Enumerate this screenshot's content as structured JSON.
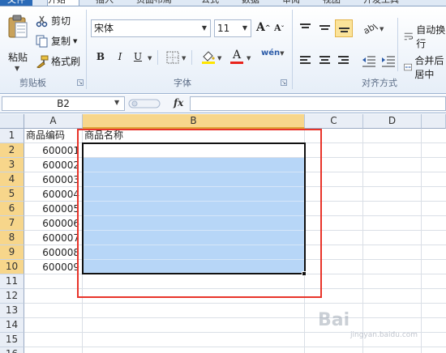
{
  "tabs": [
    "文件",
    "开始",
    "插入",
    "页面布局",
    "公式",
    "数据",
    "审阅",
    "视图",
    "开发工具"
  ],
  "clipboard": {
    "paste_label": "粘贴",
    "cut_label": "剪切",
    "copy_label": "复制",
    "format_painter_label": "格式刷",
    "group_label": "剪贴板"
  },
  "font": {
    "font_name": "宋体",
    "font_size": "11",
    "bold": "B",
    "italic": "I",
    "underline": "U",
    "grow": "A",
    "shrink": "A",
    "phonetic": "wén",
    "group_label": "字体"
  },
  "alignment": {
    "wrap_label": "自动换行",
    "merge_label": "合并后居中",
    "group_label": "对齐方式"
  },
  "formula_bar": {
    "name_box": "B2",
    "fx": "fx",
    "formula": ""
  },
  "sheet": {
    "columns": [
      "A",
      "B",
      "C",
      "D"
    ],
    "rows": [
      "1",
      "2",
      "3",
      "4",
      "5",
      "6",
      "7",
      "8",
      "9",
      "10",
      "11",
      "12",
      "13",
      "14",
      "15",
      "16"
    ],
    "header_a1": "商品编码",
    "header_b1": "商品名称",
    "codes": [
      "600001",
      "600002",
      "600003",
      "600004",
      "600005",
      "600006",
      "600007",
      "600008",
      "600009"
    ]
  },
  "watermark": {
    "text": "Bai",
    "sub": "jingyan.baidu.com"
  },
  "colors": {
    "selection_fill": "#b7d6f7",
    "highlight_box": "#e8342a",
    "header_selected": "#f7d68b"
  }
}
